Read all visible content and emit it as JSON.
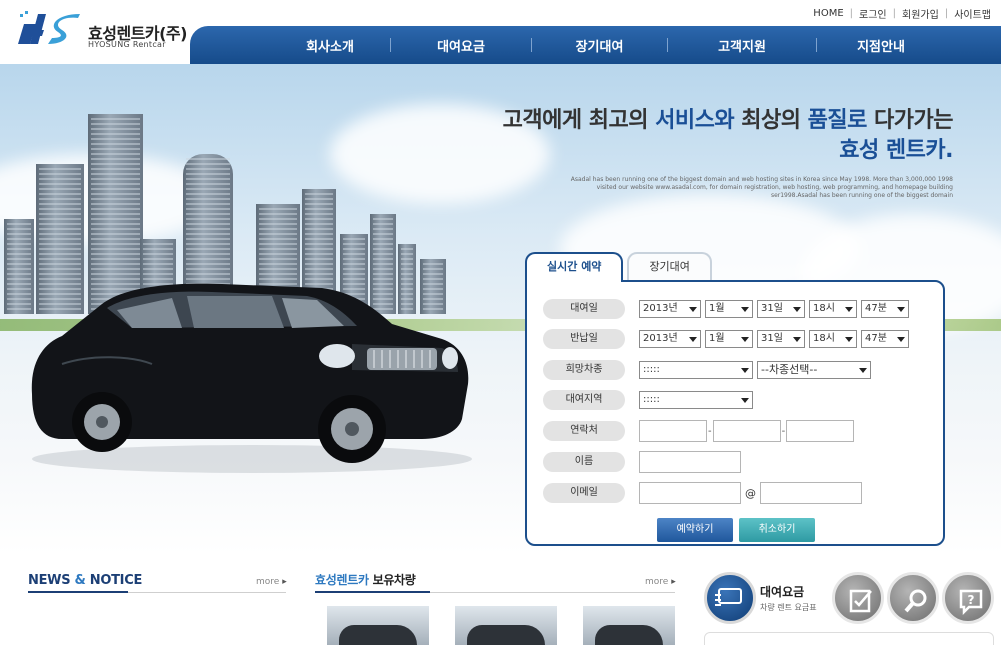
{
  "utility": [
    "HOME",
    "로그인",
    "회원가입",
    "사이트맵"
  ],
  "logo": {
    "kname": "효성렌트카(주)",
    "ename": "HYOSUNG Rentcar"
  },
  "nav": [
    "회사소개",
    "대여요금",
    "장기대여",
    "고객지원",
    "지점안내"
  ],
  "hero": {
    "line1_a": "고객에게 최고의 ",
    "line1_b": "서비스와",
    "line1_c": " 최상의 ",
    "line1_d": "품질로",
    "line1_e": " 다가가는",
    "line2": "효성 렌트카.",
    "subtext": "Asadal has been running one of the biggest domain and web hosting sites in Korea since May 1998. More than 3,000,000 1998 visited our website www.asadal.com, for domain registration, web hosting, web programming, and homepage building ser1998.Asadal has been running one of the biggest domain"
  },
  "reservation": {
    "tabs": [
      "실시간 예약",
      "장기대여"
    ],
    "labels": [
      "대여일",
      "반납일",
      "희망차종",
      "대여지역",
      "연락처",
      "이름",
      "이메일"
    ],
    "rent_date": {
      "year": "2013년",
      "month": "1월",
      "day": "31일",
      "hour": "18시",
      "minute": "47분"
    },
    "return_date": {
      "year": "2013년",
      "month": "1월",
      "day": "31일",
      "hour": "18시",
      "minute": "47분"
    },
    "car_type": {
      "first": ":::::",
      "second": "--차종선택--"
    },
    "region": ":::::",
    "at": "@",
    "dash": "-",
    "buttons": {
      "reserve": "예약하기",
      "cancel": "취소하기"
    }
  },
  "news": {
    "title_a": "NEWS",
    "title_b": " & ",
    "title_c": "NOTICE",
    "more": "more"
  },
  "cars": {
    "title_brand": "효성렌트카",
    "title_rest": " 보유차량",
    "more": "more"
  },
  "rates": {
    "title": "대여요금",
    "sub": "차량 렌트 요금표"
  },
  "colors": {
    "nav": "#1f5a9e",
    "accent": "#1c4f8c",
    "reserve": "#2a65aa",
    "cancel": "#3aa9b1"
  }
}
